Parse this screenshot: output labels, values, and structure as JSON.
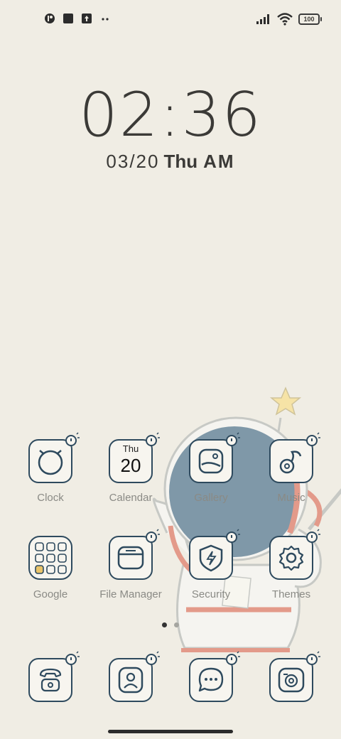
{
  "status_bar": {
    "left_icons": [
      "app-notification-icon",
      "square-notification-icon",
      "upload-icon",
      "more-dots-icon"
    ],
    "right_icons": [
      "signal-icon",
      "wifi-icon",
      "battery-icon"
    ],
    "battery_level": "100"
  },
  "lock_clock": {
    "time": "02:36",
    "date": "03/20",
    "day": "Thu",
    "ampm": "AM"
  },
  "apps_row1": [
    {
      "label": "Clock",
      "icon": "alarm-clock-icon"
    },
    {
      "label": "Calendar",
      "icon": "calendar-icon",
      "cal_day": "Thu",
      "cal_date": "20"
    },
    {
      "label": "Gallery",
      "icon": "gallery-icon"
    },
    {
      "label": "Music",
      "icon": "music-icon"
    }
  ],
  "apps_row2": [
    {
      "label": "Google",
      "icon": "google-folder-icon"
    },
    {
      "label": "File Manager",
      "icon": "folder-icon"
    },
    {
      "label": "Security",
      "icon": "shield-icon"
    },
    {
      "label": "Themes",
      "icon": "gear-icon"
    }
  ],
  "dock": [
    {
      "icon": "phone-icon"
    },
    {
      "icon": "contacts-icon"
    },
    {
      "icon": "messages-icon"
    },
    {
      "icon": "camera-icon"
    }
  ],
  "page_indicator": {
    "pages": 2,
    "current": 1
  },
  "colors": {
    "background": "#f0ede4",
    "icon_stroke": "#2e4a5e",
    "helmet": "#7f98a8",
    "suit_accent": "#e39a8a",
    "star": "#f6e3a6"
  }
}
